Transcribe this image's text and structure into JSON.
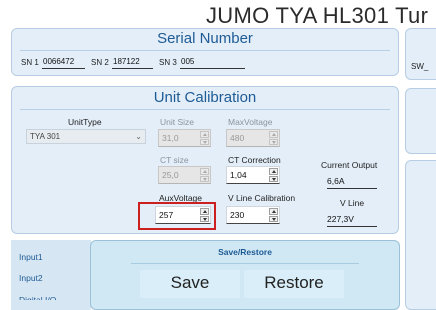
{
  "app": {
    "title": "JUMO TYA HL301 Tur"
  },
  "serial": {
    "heading": "Serial Number",
    "sn1_label": "SN 1",
    "sn1_value": "0066472",
    "sn2_label": "SN 2",
    "sn2_value": "187122",
    "sn3_label": "SN 3",
    "sn3_value": "005",
    "right_label": "SW_"
  },
  "calibration": {
    "heading": "Unit Calibration",
    "unit_type_label": "UnitType",
    "unit_type_value": "TYA 301",
    "unit_size_label": "Unit Size",
    "unit_size_value": "31,0",
    "max_voltage_label": "MaxVoltage",
    "max_voltage_value": "480",
    "ct_size_label": "CT size",
    "ct_size_value": "25,0",
    "ct_correction_label": "CT Correction",
    "ct_correction_value": "1,04",
    "aux_voltage_label": "AuxVoltage",
    "aux_voltage_value": "257",
    "v_line_cal_label": "V Line Calibration",
    "v_line_cal_value": "230",
    "current_output_label": "Current Output",
    "current_output_value": "6,6A",
    "v_line_label": "V Line",
    "v_line_value": "227,3V"
  },
  "nav": {
    "items": [
      "Input1",
      "Input2",
      "Digital I/O"
    ]
  },
  "save_restore": {
    "heading": "Save/Restore",
    "save_label": "Save",
    "restore_label": "Restore"
  },
  "colors": {
    "accent": "#1e5b94",
    "highlight": "#cc1f1f",
    "panel": "#e3eef8"
  }
}
